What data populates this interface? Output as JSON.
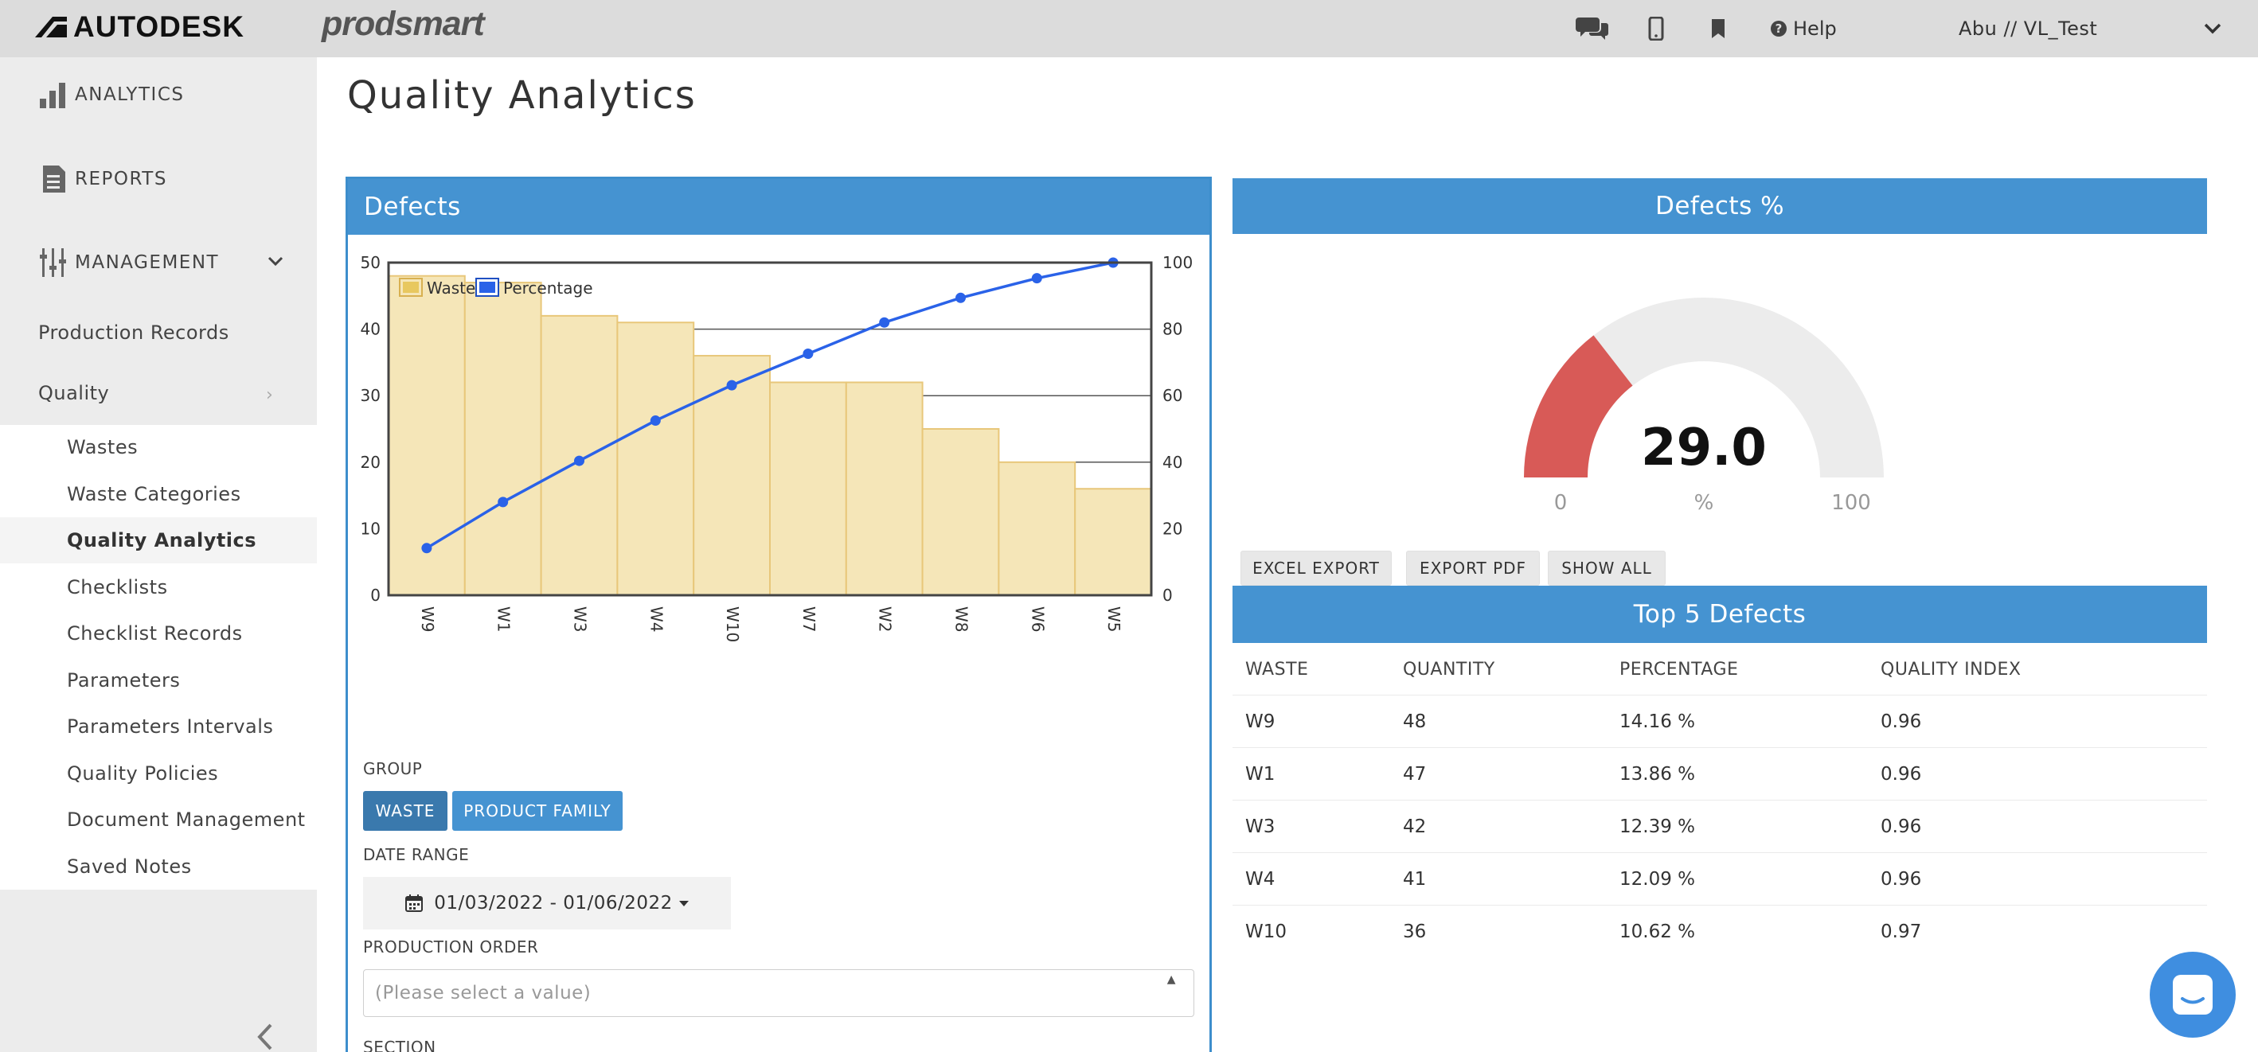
{
  "header": {
    "brand": "AUTODESK",
    "product": "prodsmart",
    "help_label": "Help",
    "user_label": "Abu // VL_Test",
    "icons": [
      "chat-icon",
      "mobile-icon",
      "bookmark-icon",
      "question-circle-icon",
      "chevron-down-icon"
    ]
  },
  "sidebar": {
    "top_items": [
      {
        "label": "ANALYTICS",
        "icon": "bar-chart-icon"
      },
      {
        "label": "REPORTS",
        "icon": "document-icon"
      },
      {
        "label": "MANAGEMENT",
        "icon": "sliders-icon"
      }
    ],
    "level1": [
      "Production Records",
      "Quality"
    ],
    "subitems": [
      "Wastes",
      "Waste Categories",
      "Quality Analytics",
      "Checklists",
      "Checklist Records",
      "Parameters",
      "Parameters Intervals",
      "Quality Policies",
      "Document Management",
      "Saved Notes"
    ],
    "active_subitem": "Quality Analytics"
  },
  "page": {
    "title": "Quality Analytics"
  },
  "defects_panel": {
    "title": "Defects",
    "group_label": "GROUP",
    "group_buttons": [
      "WASTE",
      "PRODUCT FAMILY"
    ],
    "active_group": "WASTE",
    "date_range_label": "DATE RANGE",
    "date_range_value": "01/03/2022 - 01/06/2022",
    "production_order_label": "PRODUCTION ORDER",
    "production_order_placeholder": "(Please select a value)",
    "section_label": "SECTION"
  },
  "chart_data": {
    "type": "bar",
    "categories": [
      "W9",
      "W1",
      "W3",
      "W4",
      "W10",
      "W7",
      "W2",
      "W8",
      "W6",
      "W5"
    ],
    "series": [
      {
        "name": "Waste",
        "type": "bar",
        "axis": "left",
        "values": [
          48,
          47,
          42,
          41,
          36,
          32,
          32,
          25,
          20,
          16
        ]
      },
      {
        "name": "Percentage",
        "type": "line",
        "axis": "right",
        "values": [
          14.16,
          28.02,
          40.41,
          52.5,
          63.12,
          72.6,
          82.0,
          89.4,
          95.3,
          100
        ]
      }
    ],
    "ylim_left": [
      0,
      50
    ],
    "yticks_left": [
      0,
      10,
      20,
      30,
      40,
      50
    ],
    "ylim_right": [
      0,
      100
    ],
    "yticks_right": [
      0,
      20,
      40,
      60,
      80,
      100
    ],
    "grid": true,
    "legend_position": "top-left",
    "colors": {
      "bar_fill": "#f5e6b8",
      "bar_stroke": "#e8c77a",
      "line": "#2a62e8"
    }
  },
  "gauge": {
    "title": "Defects %",
    "value": 29.0,
    "value_text": "29.0",
    "min": "0",
    "max": "100",
    "unit": "%",
    "colors": {
      "fill": "#d85a57",
      "track": "#ececec"
    }
  },
  "actions": [
    "EXCEL EXPORT",
    "EXPORT PDF",
    "SHOW ALL"
  ],
  "top5": {
    "title": "Top 5 Defects",
    "columns": [
      "WASTE",
      "QUANTITY",
      "PERCENTAGE",
      "QUALITY INDEX"
    ],
    "rows": [
      [
        "W9",
        "48",
        "14.16 %",
        "0.96"
      ],
      [
        "W1",
        "47",
        "13.86 %",
        "0.96"
      ],
      [
        "W3",
        "42",
        "12.39 %",
        "0.96"
      ],
      [
        "W4",
        "41",
        "12.09 %",
        "0.96"
      ],
      [
        "W10",
        "36",
        "10.62 %",
        "0.97"
      ]
    ]
  },
  "colors": {
    "accent": "#4593d1",
    "active_button": "#3a79ad",
    "button": "#4593d1"
  }
}
